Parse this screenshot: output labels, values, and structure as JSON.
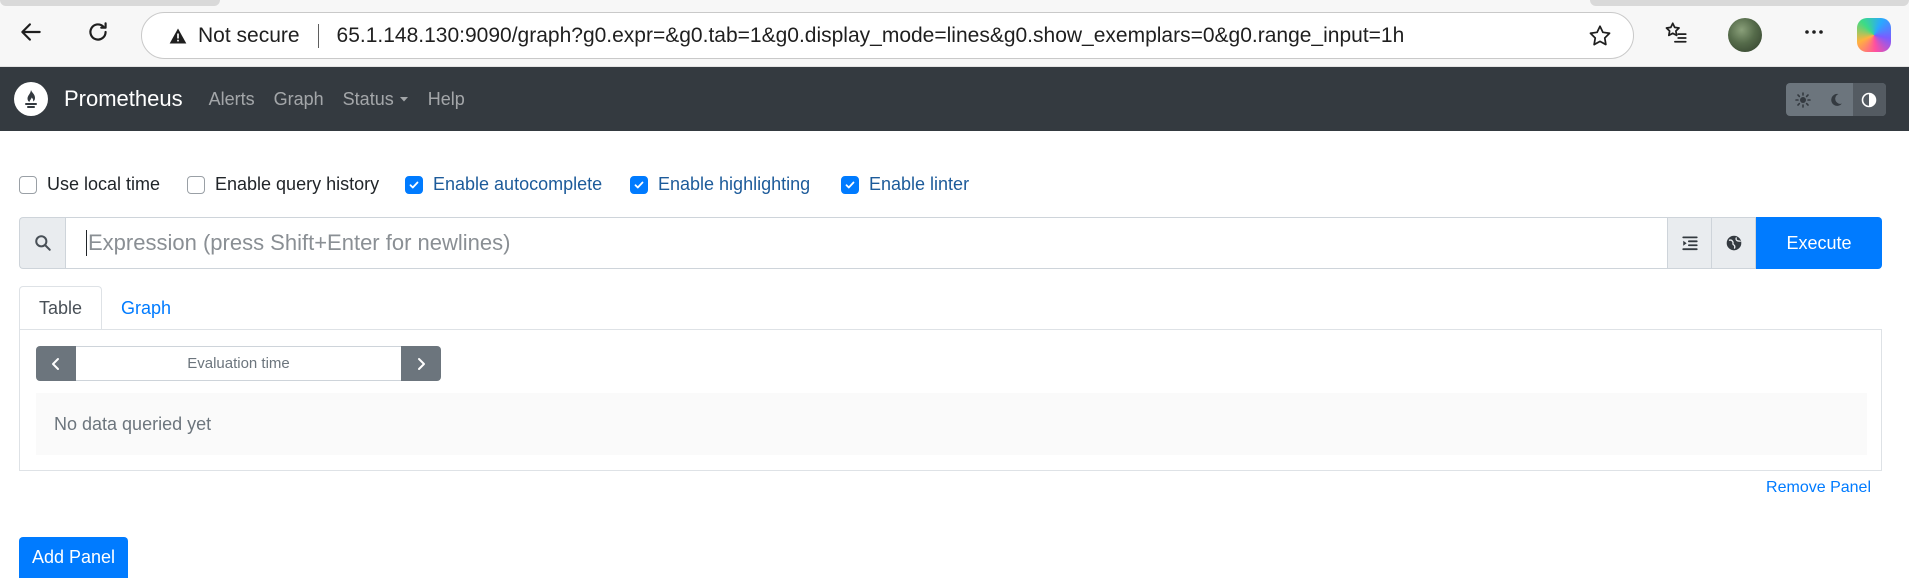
{
  "browser": {
    "security_label": "Not secure",
    "url": "65.1.148.130:9090/graph?g0.expr=&g0.tab=1&g0.display_mode=lines&g0.show_exemplars=0&g0.range_input=1h"
  },
  "navbar": {
    "brand": "Prometheus",
    "links": [
      "Alerts",
      "Graph",
      "Status",
      "Help"
    ],
    "theme_options": [
      "light",
      "dark",
      "auto"
    ],
    "active_theme": "auto"
  },
  "options": [
    {
      "label": "Use local time",
      "checked": false
    },
    {
      "label": "Enable query history",
      "checked": false
    },
    {
      "label": "Enable autocomplete",
      "checked": true
    },
    {
      "label": "Enable highlighting",
      "checked": true
    },
    {
      "label": "Enable linter",
      "checked": true
    }
  ],
  "expression": {
    "placeholder": "Expression (press Shift+Enter for newlines)",
    "value": "",
    "execute_label": "Execute"
  },
  "panel": {
    "tabs": [
      "Table",
      "Graph"
    ],
    "active_tab": "Table",
    "evaluation_time_placeholder": "Evaluation time",
    "empty_message": "No data queried yet",
    "remove_label": "Remove Panel"
  },
  "add_panel_label": "Add Panel",
  "colors": {
    "navbar_bg": "#343a40",
    "primary": "#007bff",
    "secondary": "#6c757d"
  }
}
